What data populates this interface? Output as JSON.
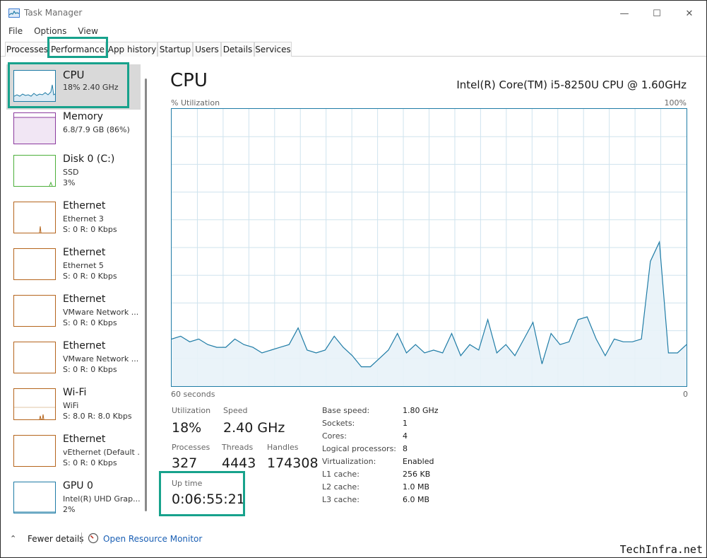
{
  "window": {
    "title": "Task Manager",
    "minimize": "—",
    "maximize": "☐",
    "close": "✕"
  },
  "menu": [
    "File",
    "Options",
    "View"
  ],
  "tabs": [
    "Processes",
    "Performance",
    "App history",
    "Startup",
    "Users",
    "Details",
    "Services"
  ],
  "active_tab": "Performance",
  "sidebar": [
    {
      "title": "CPU",
      "sub1": "18% 2.40 GHz",
      "sub2": "",
      "color": "#1f7ca6"
    },
    {
      "title": "Memory",
      "sub1": "6.8/7.9 GB (86%)",
      "sub2": "",
      "color": "#8b3a9e"
    },
    {
      "title": "Disk 0 (C:)",
      "sub1": "SSD",
      "sub2": "3%",
      "color": "#4caf3a"
    },
    {
      "title": "Ethernet",
      "sub1": "Ethernet 3",
      "sub2": "S: 0 R: 0 Kbps",
      "color": "#b5651d"
    },
    {
      "title": "Ethernet",
      "sub1": "Ethernet 5",
      "sub2": "S: 0 R: 0 Kbps",
      "color": "#b5651d"
    },
    {
      "title": "Ethernet",
      "sub1": "VMware Network ...",
      "sub2": "S: 0 R: 0 Kbps",
      "color": "#b5651d"
    },
    {
      "title": "Ethernet",
      "sub1": "VMware Network ...",
      "sub2": "S: 0 R: 0 Kbps",
      "color": "#b5651d"
    },
    {
      "title": "Wi-Fi",
      "sub1": "WiFi",
      "sub2": "S: 8.0 R: 8.0 Kbps",
      "color": "#b5651d"
    },
    {
      "title": "Ethernet",
      "sub1": "vEthernet (Default ...",
      "sub2": "S: 0 R: 0 Kbps",
      "color": "#b5651d"
    },
    {
      "title": "GPU 0",
      "sub1": "Intel(R) UHD Grap...",
      "sub2": "2%",
      "color": "#1f7ca6"
    }
  ],
  "main": {
    "title": "CPU",
    "model": "Intel(R) Core(TM) i5-8250U CPU @ 1.60GHz",
    "graph_label": "% Utilization",
    "graph_max": "100%",
    "graph_time": "60 seconds",
    "graph_zero": "0"
  },
  "chart_data": {
    "type": "area",
    "xlabel": "60 seconds",
    "ylabel": "% Utilization",
    "ylim": [
      0,
      100
    ],
    "xlim": [
      60,
      0
    ],
    "values": [
      17,
      18,
      16,
      17,
      15,
      14,
      14,
      17,
      15,
      14,
      12,
      13,
      14,
      15,
      21,
      13,
      12,
      13,
      18,
      14,
      11,
      7,
      7,
      10,
      13,
      19,
      12,
      15,
      12,
      13,
      12,
      19,
      11,
      15,
      13,
      24,
      12,
      15,
      11,
      17,
      23,
      8,
      19,
      15,
      16,
      24,
      25,
      17,
      11,
      17,
      16,
      16,
      17,
      45,
      52,
      12,
      12,
      15
    ],
    "grid": true,
    "color": "#1f7ca6"
  },
  "stats": {
    "utilization_label": "Utilization",
    "utilization": "18%",
    "speed_label": "Speed",
    "speed": "2.40 GHz",
    "processes_label": "Processes",
    "processes": "327",
    "threads_label": "Threads",
    "threads": "4443",
    "handles_label": "Handles",
    "handles": "174308",
    "uptime_label": "Up time",
    "uptime": "0:06:55:21"
  },
  "details": [
    {
      "label": "Base speed:",
      "value": "1.80 GHz"
    },
    {
      "label": "Sockets:",
      "value": "1"
    },
    {
      "label": "Cores:",
      "value": "4"
    },
    {
      "label": "Logical processors:",
      "value": "8"
    },
    {
      "label": "Virtualization:",
      "value": "Enabled"
    },
    {
      "label": "L1 cache:",
      "value": "256 KB"
    },
    {
      "label": "L2 cache:",
      "value": "1.0 MB"
    },
    {
      "label": "L3 cache:",
      "value": "6.0 MB"
    }
  ],
  "footer": {
    "fewer_details": "Fewer details",
    "resource_monitor": "Open Resource Monitor"
  },
  "watermark": "TechInfra.net",
  "accent": "#17a28c"
}
